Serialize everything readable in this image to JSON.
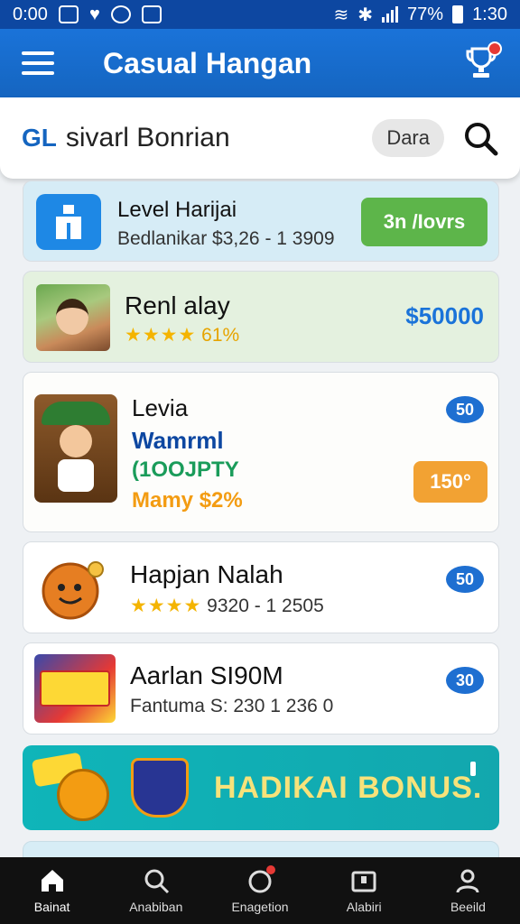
{
  "status_bar": {
    "time_left": "0:00",
    "battery": "77%",
    "time_right": "1:30"
  },
  "app_bar": {
    "title": "Casual Hangan"
  },
  "search": {
    "brand": "GL",
    "text": "sivarl Bonrian",
    "chip": "Dara"
  },
  "cards": [
    {
      "title": "Level Harijai",
      "subtitle": "Bedlanikar $3,26 - 1 3909",
      "action": "3n /Iovrs"
    },
    {
      "title": "Renl alay",
      "stars": "★★★★",
      "rating": "61%",
      "price": "$50000"
    },
    {
      "title": "Levia",
      "line2": "Wamrml",
      "line3": "(1OOJPTY",
      "line4": "Mamy $2%",
      "badge": "50",
      "action": "150°"
    },
    {
      "title": "Hapjan Nalah",
      "stars": "★★★★",
      "meta": "9320 - 1 2505",
      "badge": "50"
    },
    {
      "title": "Aarlan SI90M",
      "meta": "Fantuma S: 230 1 236 0",
      "badge": "30"
    }
  ],
  "banner": {
    "text": "HADIKAI BONUS."
  },
  "bottom_nav": [
    {
      "label": "Bainat",
      "icon": "home-icon"
    },
    {
      "label": "Anabiban",
      "icon": "search-icon"
    },
    {
      "label": "Enagetion",
      "icon": "notification-icon"
    },
    {
      "label": "Alabiri",
      "icon": "inbox-icon"
    },
    {
      "label": "Beeild",
      "icon": "profile-icon"
    }
  ],
  "colors": {
    "app_bar": "#1565c0",
    "accent_green": "#5db54a",
    "accent_orange": "#f2a233",
    "banner": "#12a7ae"
  }
}
